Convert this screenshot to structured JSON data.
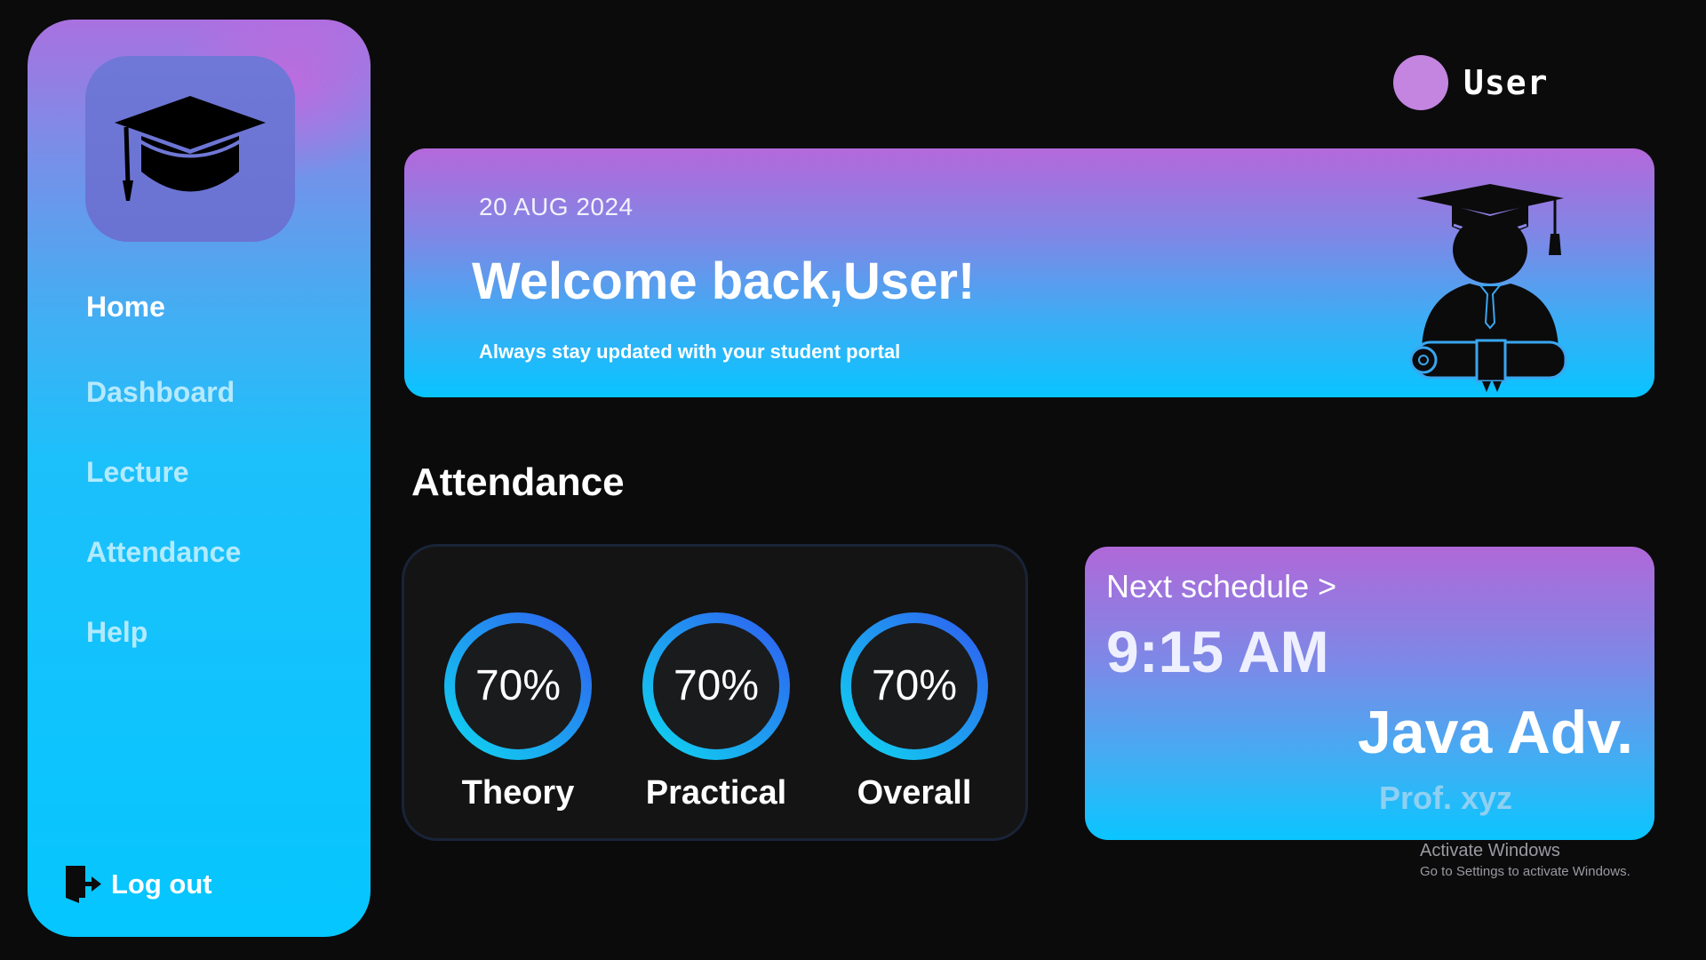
{
  "sidebar": {
    "logo_icon": "graduation-cap-icon",
    "items": [
      {
        "label": "Home",
        "active": true
      },
      {
        "label": "Dashboard",
        "active": false
      },
      {
        "label": "Lecture",
        "active": false
      },
      {
        "label": "Attendance",
        "active": false
      },
      {
        "label": "Help",
        "active": false
      }
    ],
    "logout": {
      "label": "Log out",
      "icon": "logout-door-icon"
    }
  },
  "header": {
    "user_name": "User",
    "avatar_color": "#c385df"
  },
  "banner": {
    "date": "20 AUG 2024",
    "title": "Welcome back,User!",
    "subtitle": "Always stay updated with your student portal",
    "illustration": "graduate-student-icon"
  },
  "attendance": {
    "title": "Attendance",
    "items": [
      {
        "label": "Theory",
        "value": "70%"
      },
      {
        "label": "Practical",
        "value": "70%"
      },
      {
        "label": "Overall",
        "value": "70%"
      }
    ]
  },
  "schedule": {
    "heading": "Next schedule >",
    "time": "9:15 AM",
    "course": "Java Adv.",
    "professor": "Prof. xyz"
  },
  "watermark": {
    "title": "Activate Windows",
    "subtitle": "Go to Settings to activate Windows."
  },
  "colors": {
    "background": "#0b0b0c",
    "gradient_top": "#b468da",
    "gradient_bottom": "#05c6ff",
    "ring_start": "#0fd6f0",
    "ring_end": "#2f5ef0"
  }
}
